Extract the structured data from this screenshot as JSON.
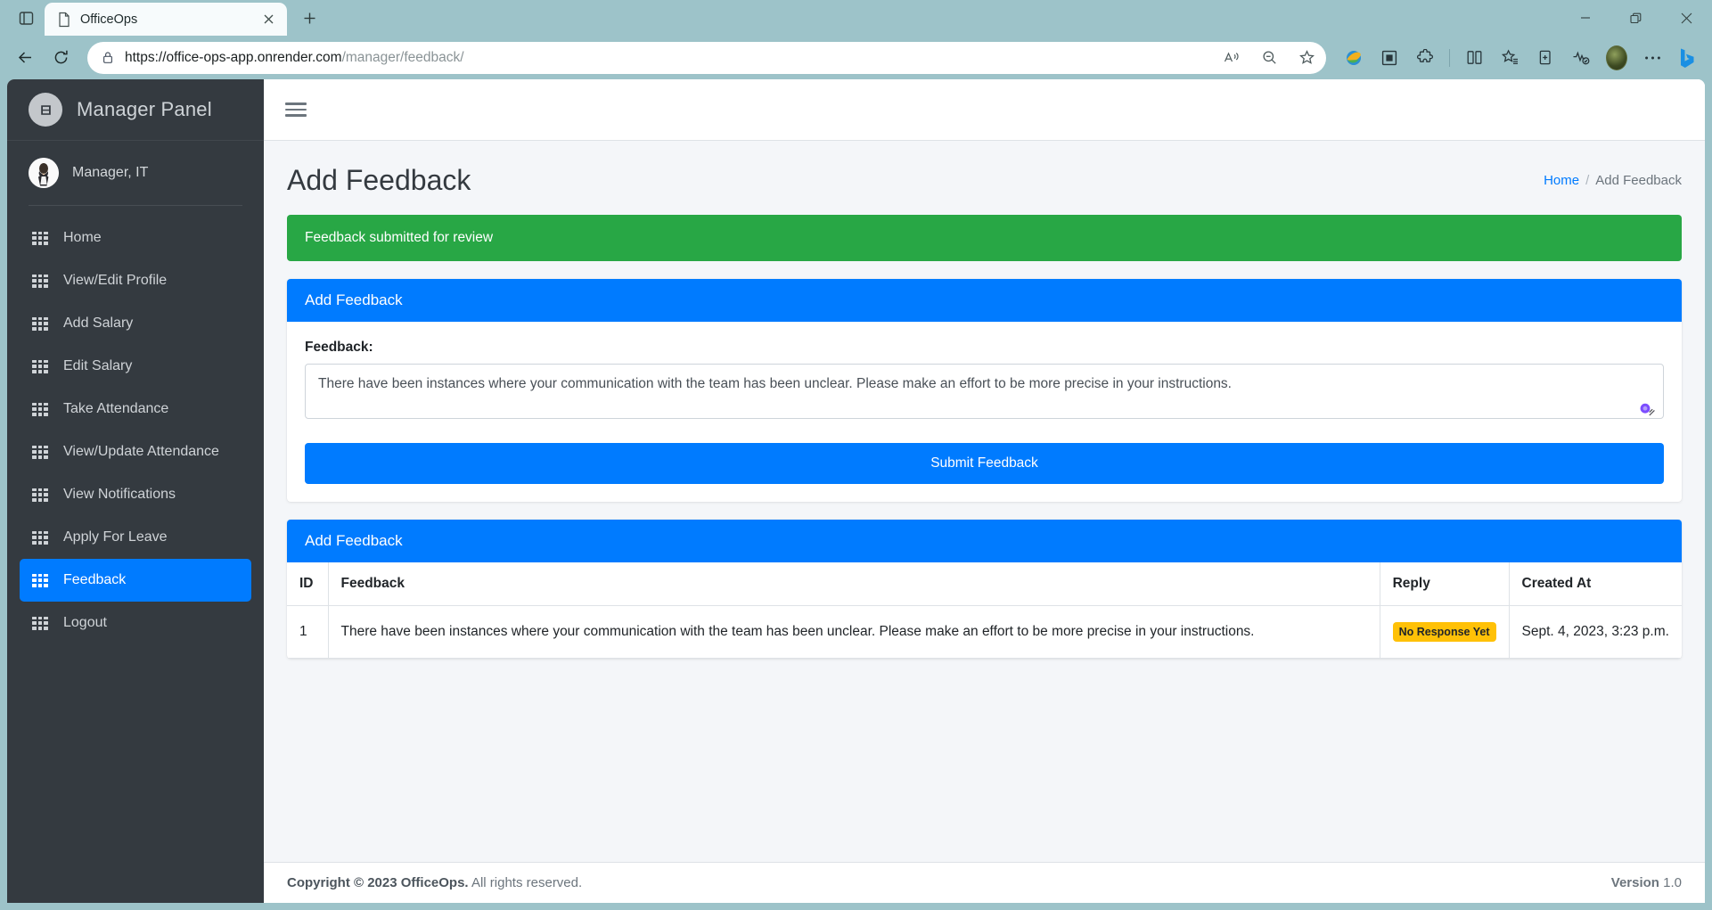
{
  "browser": {
    "tab": {
      "title": "OfficeOps",
      "favicon_icon": "page-icon",
      "close_icon": "close-icon"
    },
    "tab_list_icon": "tab-list-icon",
    "new_tab_icon": "plus-icon",
    "window": {
      "minimize_icon": "minimize-icon",
      "maximize_icon": "restore-icon",
      "close_icon": "close-icon"
    },
    "nav": {
      "back_icon": "back-arrow-icon",
      "reload_icon": "reload-icon"
    },
    "omnibox": {
      "lock_icon": "lock-icon",
      "url_prefix": "https://office-ops-app.onrender.com",
      "url_path": "/manager/feedback/",
      "read_aloud_icon": "read-aloud-icon",
      "zoom_icon": "zoom-out-icon",
      "favorite_icon": "star-icon"
    },
    "extensions": [
      {
        "name": "ie-mode-icon"
      },
      {
        "name": "app-window-icon"
      },
      {
        "name": "extensions-puzzle-icon"
      },
      {
        "name": "split-screen-icon"
      },
      {
        "name": "collections-icon"
      },
      {
        "name": "add-device-icon"
      },
      {
        "name": "browser-essentials-icon"
      },
      {
        "name": "profile-avatar"
      },
      {
        "name": "settings-more-icon"
      },
      {
        "name": "copilot-bing-icon"
      }
    ]
  },
  "sidebar": {
    "brand": {
      "label": "Manager Panel",
      "logo_icon": "officeops-logo-icon"
    },
    "user": {
      "name": "Manager, IT",
      "avatar_icon": "user-avatar"
    },
    "items": [
      {
        "label": "Home",
        "icon": "grid-icon",
        "active": false
      },
      {
        "label": "View/Edit Profile",
        "icon": "grid-icon",
        "active": false
      },
      {
        "label": "Add Salary",
        "icon": "grid-icon",
        "active": false
      },
      {
        "label": "Edit Salary",
        "icon": "grid-icon",
        "active": false
      },
      {
        "label": "Take Attendance",
        "icon": "grid-icon",
        "active": false
      },
      {
        "label": "View/Update Attendance",
        "icon": "grid-icon",
        "active": false
      },
      {
        "label": "View Notifications",
        "icon": "grid-icon",
        "active": false
      },
      {
        "label": "Apply For Leave",
        "icon": "grid-icon",
        "active": false
      },
      {
        "label": "Feedback",
        "icon": "grid-icon",
        "active": true
      },
      {
        "label": "Logout",
        "icon": "grid-icon",
        "active": false
      }
    ]
  },
  "topbar": {
    "menu_toggle_icon": "hamburger-icon"
  },
  "page": {
    "title": "Add Feedback",
    "breadcrumb": {
      "home": "Home",
      "separator": "/",
      "current": "Add Feedback"
    }
  },
  "alert": {
    "message": "Feedback submitted for review"
  },
  "form_card": {
    "header": "Add Feedback",
    "field_label": "Feedback:",
    "textarea_value": "There have been instances where your communication with the team has been unclear. Please make an effort to be more precise in your instructions.",
    "textarea_placeholder": "",
    "submit_label": "Submit Feedback",
    "assistant_badge_icon": "grammar-assistant-icon",
    "resize_handle_icon": "resize-handle-icon"
  },
  "table_card": {
    "header": "Add Feedback",
    "columns": [
      "ID",
      "Feedback",
      "Reply",
      "Created At"
    ],
    "rows": [
      {
        "id": "1",
        "feedback": "There have been instances where your communication with the team has been unclear. Please make an effort to be more precise in your instructions.",
        "reply": "No Response Yet",
        "created_at": "Sept. 4, 2023, 3:23 p.m."
      }
    ]
  },
  "footer": {
    "copyright_strong": "Copyright © 2023 OfficeOps.",
    "copyright_rest": " All rights reserved.",
    "version_label": "Version",
    "version_value": "1.0"
  },
  "colors": {
    "primary": "#007bff",
    "success": "#28a745",
    "warning": "#ffc107",
    "sidebar_bg": "#343a40",
    "content_bg": "#f4f6f9"
  }
}
